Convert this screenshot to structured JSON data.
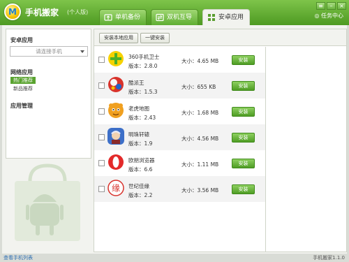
{
  "app": {
    "logo_letter": "M",
    "title": "手机搬家",
    "edition": "(个人版)",
    "task_center": "任务中心",
    "version": "手机搬家1.1.0"
  },
  "tabs": [
    {
      "label": "单机备份",
      "icon": "single-backup-icon",
      "active": false
    },
    {
      "label": "双机互导",
      "icon": "dual-transfer-icon",
      "active": false
    },
    {
      "label": "安卓应用",
      "icon": "android-apps-icon",
      "active": true
    }
  ],
  "sidebar": {
    "section_apps": "安卓应用",
    "device_placeholder": "请连接手机",
    "section_network": "网络应用",
    "items": [
      {
        "label": "热门推荐",
        "active": true
      },
      {
        "label": "新品推荐",
        "active": false
      }
    ],
    "section_manage": "应用管理"
  },
  "toolbar": {
    "install_local": "安装本地应用",
    "one_click_install": "一键安装"
  },
  "apps": [
    {
      "name": "360手机卫士",
      "version_label": "版本：2.8.0",
      "size_label": "大小：4.65 MB",
      "install": "安装",
      "icon": "360-guard-icon",
      "color": "#7ec23a"
    },
    {
      "name": "酷派王",
      "version_label": "版本：1.5.3",
      "size_label": "大小：655 KB",
      "install": "安装",
      "icon": "ball-icon",
      "color": "#d8332c"
    },
    {
      "name": "老虎地图",
      "version_label": "版本：2.43",
      "size_label": "大小：1.68 MB",
      "install": "安装",
      "icon": "tiger-icon",
      "color": "#f0a020"
    },
    {
      "name": "明珠轩辕",
      "version_label": "版本：1.9",
      "size_label": "大小：4.56 MB",
      "install": "安装",
      "icon": "game-character-icon",
      "color": "#3d6fc8"
    },
    {
      "name": "欧朋浏览器",
      "version_label": "版本：6.6",
      "size_label": "大小：1.11 MB",
      "install": "安装",
      "icon": "opera-icon",
      "color": "#e32a2a"
    },
    {
      "name": "世纪佳缘",
      "version_label": "版本：2.2",
      "size_label": "大小：3.56 MB",
      "install": "安装",
      "icon": "jiayuan-icon",
      "color": "#d8322c"
    }
  ],
  "status": {
    "left": "查看手机列表"
  }
}
